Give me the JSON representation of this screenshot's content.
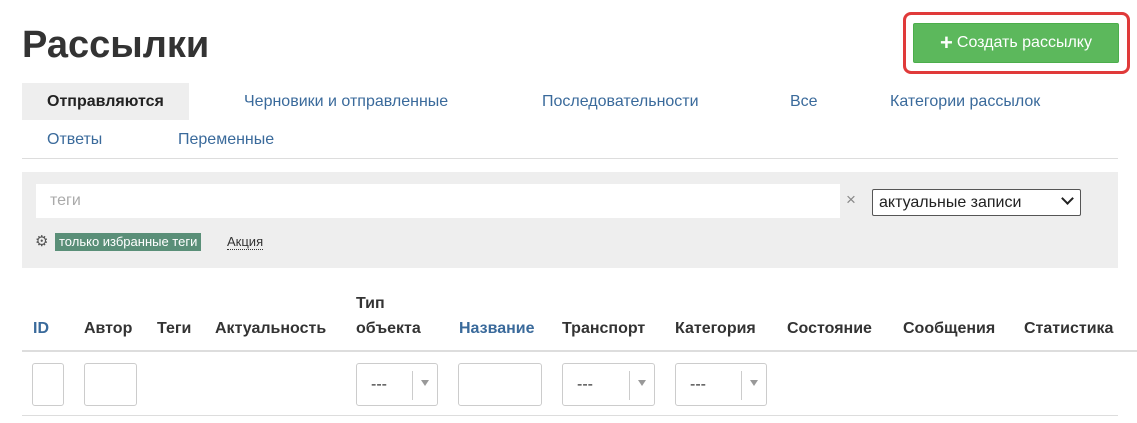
{
  "page": {
    "title": "Рассылки"
  },
  "toolbar": {
    "create_label": "Создать рассылку",
    "create_icon": "plus-icon"
  },
  "colors": {
    "accent": "#5cb85c",
    "highlight": "#e03a3a",
    "link": "#3a6a9b",
    "tag_badge": "#5a8f78"
  },
  "tabs": [
    {
      "label": "Отправляются",
      "active": true
    },
    {
      "label": "Черновики и отправленные",
      "active": false
    },
    {
      "label": "Последовательности",
      "active": false
    },
    {
      "label": "Все",
      "active": false
    },
    {
      "label": "Категории рассылок",
      "active": false
    },
    {
      "label": "Ответы",
      "active": false
    },
    {
      "label": "Переменные",
      "active": false
    }
  ],
  "filters": {
    "tags_placeholder": "теги",
    "clear_label": "×",
    "scope_value": "актуальные записи",
    "favorites_label": "только избранные теги",
    "tag_chip": "Акция"
  },
  "table": {
    "columns": [
      {
        "label": "ID",
        "sortable": true
      },
      {
        "label": "Автор",
        "sortable": false
      },
      {
        "label": "Теги",
        "sortable": false
      },
      {
        "label": "Актуальность",
        "sortable": false
      },
      {
        "label_line1": "Тип",
        "label_line2": "объекта",
        "sortable": false
      },
      {
        "label": "Название",
        "sortable": true
      },
      {
        "label": "Транспорт",
        "sortable": false
      },
      {
        "label": "Категория",
        "sortable": false
      },
      {
        "label": "Состояние",
        "sortable": false
      },
      {
        "label": "Сообщения",
        "sortable": false
      },
      {
        "label": "Статистика",
        "sortable": false
      }
    ],
    "filter_row": {
      "object_type": "---",
      "transport": "---",
      "category": "---"
    }
  }
}
